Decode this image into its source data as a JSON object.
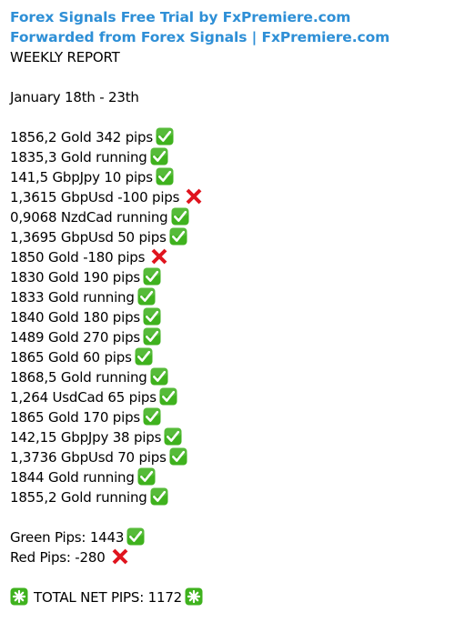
{
  "header": {
    "title_link": "Forex Signals Free Trial by FxPremiere.com",
    "forwarded_link": "Forwarded from Forex Signals | FxPremiere.com"
  },
  "report": {
    "title": "WEEKLY REPORT",
    "date_range": "January 18th - 23th",
    "signals": [
      {
        "text": "1856,2 Gold 342 pips",
        "result": "check-mark-icon"
      },
      {
        "text": "1835,3 Gold running",
        "result": "check-mark-icon"
      },
      {
        "text": "141,5 GbpJpy 10 pips",
        "result": "check-mark-icon"
      },
      {
        "text": "1,3615 GbpUsd -100 pips",
        "result": "cross-mark-icon"
      },
      {
        "text": "0,9068 NzdCad running",
        "result": "check-mark-icon"
      },
      {
        "text": "1,3695 GbpUsd 50 pips",
        "result": "check-mark-icon"
      },
      {
        "text": "1850 Gold -180 pips",
        "result": "cross-mark-icon"
      },
      {
        "text": "1830 Gold 190 pips",
        "result": "check-mark-icon"
      },
      {
        "text": "1833 Gold running",
        "result": "check-mark-icon"
      },
      {
        "text": "1840 Gold 180 pips",
        "result": "check-mark-icon"
      },
      {
        "text": "1489 Gold 270 pips",
        "result": "check-mark-icon"
      },
      {
        "text": "1865 Gold 60 pips",
        "result": "check-mark-icon"
      },
      {
        "text": "1868,5 Gold running",
        "result": "check-mark-icon"
      },
      {
        "text": "1,264 UsdCad 65 pips",
        "result": "check-mark-icon"
      },
      {
        "text": "1865 Gold 170 pips",
        "result": "check-mark-icon"
      },
      {
        "text": "142,15 GbpJpy 38 pips",
        "result": "check-mark-icon"
      },
      {
        "text": "1,3736 GbpUsd 70 pips",
        "result": "check-mark-icon"
      },
      {
        "text": "1844 Gold running",
        "result": "check-mark-icon"
      },
      {
        "text": "1855,2 Gold running",
        "result": "check-mark-icon"
      }
    ],
    "green_pips": "Green Pips: 1443",
    "red_pips": "Red Pips: -280",
    "total_net_pips": "TOTAL NET PIPS: 1172"
  },
  "colors": {
    "link": "#2e8fd6",
    "check_green": "#3fb21e",
    "cross_red": "#e0141e"
  }
}
